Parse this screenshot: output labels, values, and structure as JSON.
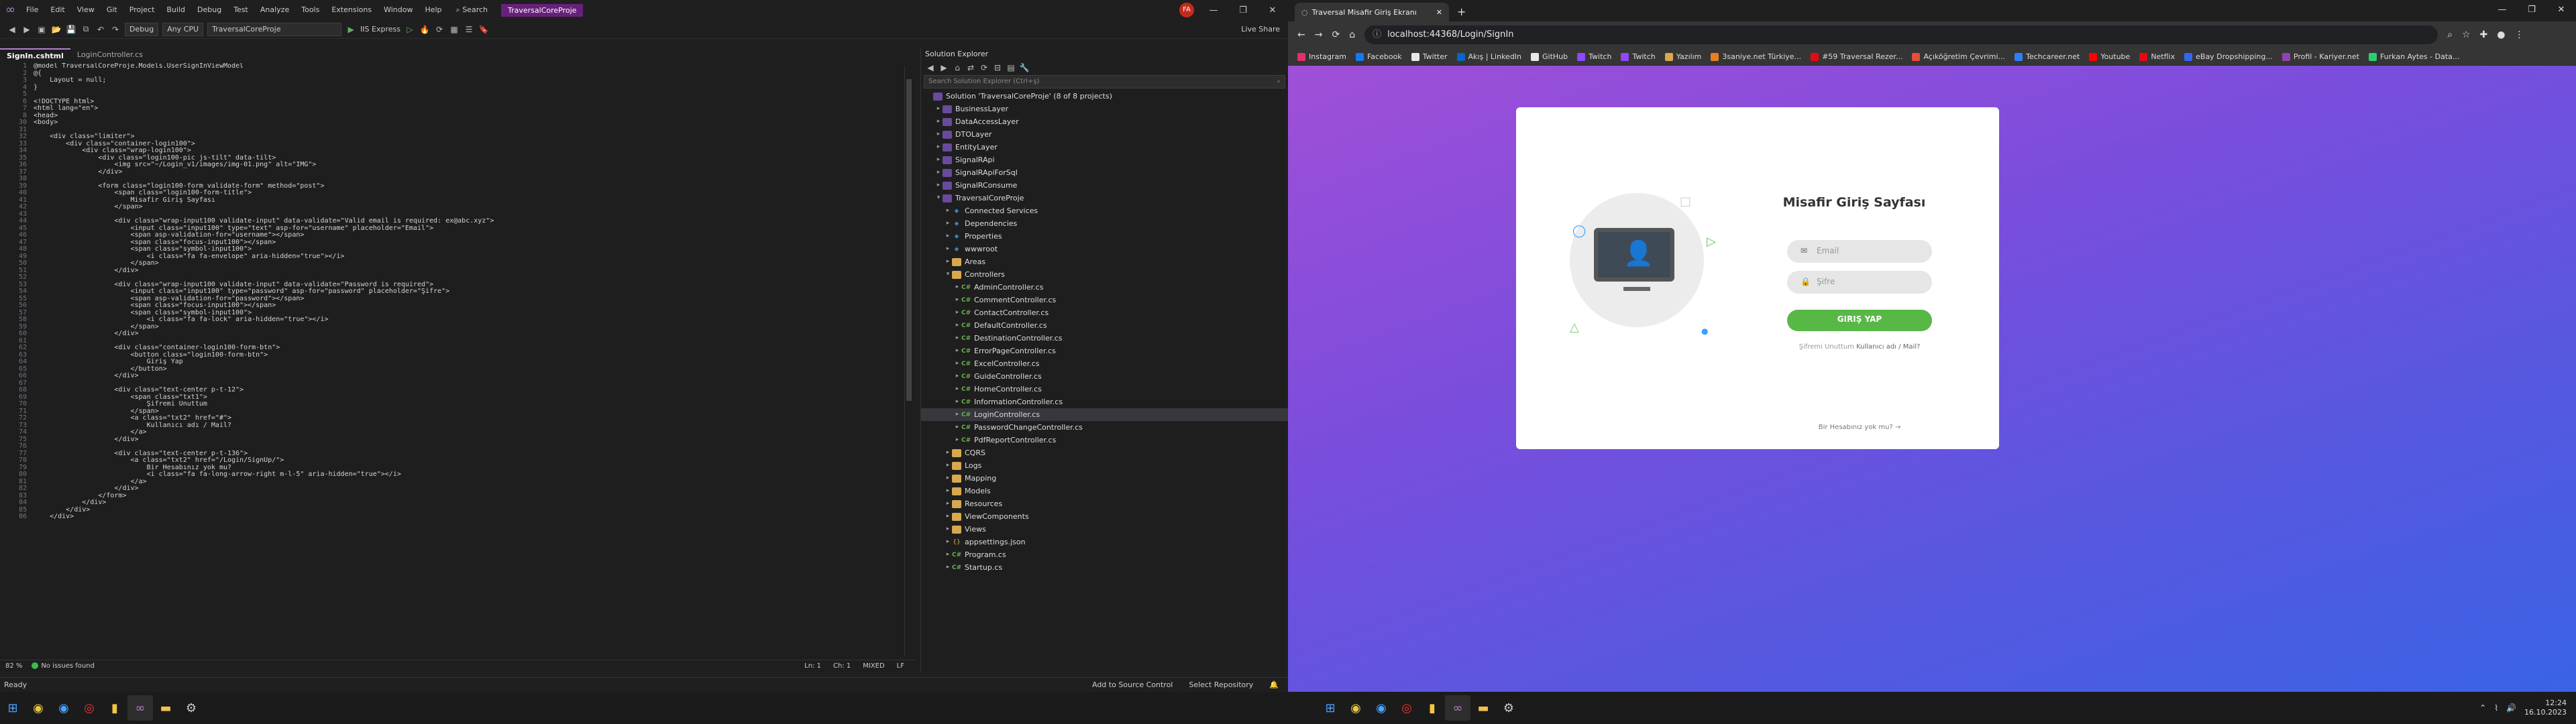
{
  "vs": {
    "menu": [
      "File",
      "Edit",
      "View",
      "Git",
      "Project",
      "Build",
      "Debug",
      "Test",
      "Analyze",
      "Tools",
      "Extensions",
      "Window",
      "Help"
    ],
    "search_label": "Search",
    "solution_name": "TraversalCoreProje",
    "avatar_initials": "FA",
    "live_share": "Live Share",
    "toolbar": {
      "config": "Debug",
      "platform": "Any CPU",
      "startup_project": "TraversalCoreProje",
      "run_target": "IIS Express"
    },
    "tabs": [
      "SignIn.cshtml",
      "LoginController.cs"
    ],
    "breadcrumb": "",
    "code": [
      {
        "n": "1",
        "t": "@model TraversalCoreProje.Models.UserSignInViewModel"
      },
      {
        "n": "2",
        "t": "@{"
      },
      {
        "n": "3",
        "t": "    Layout = null;"
      },
      {
        "n": "4",
        "t": "}"
      },
      {
        "n": "5",
        "t": ""
      },
      {
        "n": "6",
        "t": "<!DOCTYPE html>"
      },
      {
        "n": "7",
        "t": "<html lang=\"en\">"
      },
      {
        "n": "8",
        "t": "<head>"
      },
      {
        "n": "30",
        "t": "<body>"
      },
      {
        "n": "31",
        "t": ""
      },
      {
        "n": "32",
        "t": "    <div class=\"limiter\">"
      },
      {
        "n": "33",
        "t": "        <div class=\"container-login100\">"
      },
      {
        "n": "34",
        "t": "            <div class=\"wrap-login100\">"
      },
      {
        "n": "35",
        "t": "                <div class=\"login100-pic js-tilt\" data-tilt>"
      },
      {
        "n": "36",
        "t": "                    <img src=\"~/Login_v1/images/img-01.png\" alt=\"IMG\">"
      },
      {
        "n": "37",
        "t": "                </div>"
      },
      {
        "n": "38",
        "t": ""
      },
      {
        "n": "39",
        "t": "                <form class=\"login100-form validate-form\" method=\"post\">"
      },
      {
        "n": "40",
        "t": "                    <span class=\"login100-form-title\">"
      },
      {
        "n": "41",
        "t": "                        Misafir Giriş Sayfası"
      },
      {
        "n": "42",
        "t": "                    </span>"
      },
      {
        "n": "43",
        "t": ""
      },
      {
        "n": "44",
        "t": "                    <div class=\"wrap-input100 validate-input\" data-validate=\"Valid email is required: ex@abc.xyz\">"
      },
      {
        "n": "45",
        "t": "                        <input class=\"input100\" type=\"text\" asp-for=\"username\" placeholder=\"Email\">"
      },
      {
        "n": "46",
        "t": "                        <span asp-validation-for=\"username\"></span>"
      },
      {
        "n": "47",
        "t": "                        <span class=\"focus-input100\"></span>"
      },
      {
        "n": "48",
        "t": "                        <span class=\"symbol-input100\">"
      },
      {
        "n": "49",
        "t": "                            <i class=\"fa fa-envelope\" aria-hidden=\"true\"></i>"
      },
      {
        "n": "50",
        "t": "                        </span>"
      },
      {
        "n": "51",
        "t": "                    </div>"
      },
      {
        "n": "52",
        "t": ""
      },
      {
        "n": "53",
        "t": "                    <div class=\"wrap-input100 validate-input\" data-validate=\"Password is required\">"
      },
      {
        "n": "54",
        "t": "                        <input class=\"input100\" type=\"password\" asp-for=\"password\" placeholder=\"Şifre\">"
      },
      {
        "n": "55",
        "t": "                        <span asp-validation-for=\"password\"></span>"
      },
      {
        "n": "56",
        "t": "                        <span class=\"focus-input100\"></span>"
      },
      {
        "n": "57",
        "t": "                        <span class=\"symbol-input100\">"
      },
      {
        "n": "58",
        "t": "                            <i class=\"fa fa-lock\" aria-hidden=\"true\"></i>"
      },
      {
        "n": "59",
        "t": "                        </span>"
      },
      {
        "n": "60",
        "t": "                    </div>"
      },
      {
        "n": "61",
        "t": ""
      },
      {
        "n": "62",
        "t": "                    <div class=\"container-login100-form-btn\">"
      },
      {
        "n": "63",
        "t": "                        <button class=\"login100-form-btn\">"
      },
      {
        "n": "64",
        "t": "                            Giriş Yap"
      },
      {
        "n": "65",
        "t": "                        </button>"
      },
      {
        "n": "66",
        "t": "                    </div>"
      },
      {
        "n": "67",
        "t": ""
      },
      {
        "n": "68",
        "t": "                    <div class=\"text-center p-t-12\">"
      },
      {
        "n": "69",
        "t": "                        <span class=\"txt1\">"
      },
      {
        "n": "70",
        "t": "                            Şifremi Unuttum"
      },
      {
        "n": "71",
        "t": "                        </span>"
      },
      {
        "n": "72",
        "t": "                        <a class=\"txt2\" href=\"#\">"
      },
      {
        "n": "73",
        "t": "                            Kullanıcı adı / Mail?"
      },
      {
        "n": "74",
        "t": "                        </a>"
      },
      {
        "n": "75",
        "t": "                    </div>"
      },
      {
        "n": "76",
        "t": ""
      },
      {
        "n": "77",
        "t": "                    <div class=\"text-center p-t-136\">"
      },
      {
        "n": "78",
        "t": "                        <a class=\"txt2\" href=\"/Login/SignUp/\">"
      },
      {
        "n": "79",
        "t": "                            Bir Hesabınız yok mu?"
      },
      {
        "n": "80",
        "t": "                            <i class=\"fa fa-long-arrow-right m-l-5\" aria-hidden=\"true\"></i>"
      },
      {
        "n": "81",
        "t": "                        </a>"
      },
      {
        "n": "82",
        "t": "                    </div>"
      },
      {
        "n": "83",
        "t": "                </form>"
      },
      {
        "n": "84",
        "t": "            </div>"
      },
      {
        "n": "85",
        "t": "        </div>"
      },
      {
        "n": "86",
        "t": "    </div>"
      }
    ],
    "editor_status": {
      "zoom": "82 %",
      "issues": "No issues found",
      "ln": "Ln: 1",
      "ch": "Ch: 1",
      "mode": "MIXED",
      "eol": "LF"
    },
    "solution_explorer": {
      "title": "Solution Explorer",
      "search_placeholder": "Search Solution Explorer (Ctrl+ş)",
      "items": [
        {
          "label": "Solution 'TraversalCoreProje' (8 of 8 projects)",
          "depth": 0,
          "icon": "sol",
          "arrow": ""
        },
        {
          "label": "BusinessLayer",
          "depth": 1,
          "icon": "proj",
          "arrow": "▸"
        },
        {
          "label": "DataAccessLayer",
          "depth": 1,
          "icon": "proj",
          "arrow": "▸"
        },
        {
          "label": "DTOLayer",
          "depth": 1,
          "icon": "proj",
          "arrow": "▸"
        },
        {
          "label": "EntityLayer",
          "depth": 1,
          "icon": "proj",
          "arrow": "▸"
        },
        {
          "label": "SignalRApi",
          "depth": 1,
          "icon": "proj",
          "arrow": "▸"
        },
        {
          "label": "SignalRApiForSql",
          "depth": 1,
          "icon": "proj",
          "arrow": "▸"
        },
        {
          "label": "SignalRConsume",
          "depth": 1,
          "icon": "proj",
          "arrow": "▸"
        },
        {
          "label": "TraversalCoreProje",
          "depth": 1,
          "icon": "proj",
          "arrow": "▾"
        },
        {
          "label": "Connected Services",
          "depth": 2,
          "icon": "glb",
          "arrow": "▸"
        },
        {
          "label": "Dependencies",
          "depth": 2,
          "icon": "glb",
          "arrow": "▸"
        },
        {
          "label": "Properties",
          "depth": 2,
          "icon": "glb",
          "arrow": "▸"
        },
        {
          "label": "wwwroot",
          "depth": 2,
          "icon": "glb",
          "arrow": "▸"
        },
        {
          "label": "Areas",
          "depth": 2,
          "icon": "folder",
          "arrow": "▸"
        },
        {
          "label": "Controllers",
          "depth": 2,
          "icon": "folder",
          "arrow": "▾"
        },
        {
          "label": "AdminController.cs",
          "depth": 3,
          "icon": "cs",
          "arrow": "▸"
        },
        {
          "label": "CommentController.cs",
          "depth": 3,
          "icon": "cs",
          "arrow": "▸"
        },
        {
          "label": "ContactController.cs",
          "depth": 3,
          "icon": "cs",
          "arrow": "▸"
        },
        {
          "label": "DefaultController.cs",
          "depth": 3,
          "icon": "cs",
          "arrow": "▸"
        },
        {
          "label": "DestinationController.cs",
          "depth": 3,
          "icon": "cs",
          "arrow": "▸"
        },
        {
          "label": "ErrorPageController.cs",
          "depth": 3,
          "icon": "cs",
          "arrow": "▸"
        },
        {
          "label": "ExcelController.cs",
          "depth": 3,
          "icon": "cs",
          "arrow": "▸"
        },
        {
          "label": "GuideController.cs",
          "depth": 3,
          "icon": "cs",
          "arrow": "▸"
        },
        {
          "label": "HomeController.cs",
          "depth": 3,
          "icon": "cs",
          "arrow": "▸"
        },
        {
          "label": "InformationController.cs",
          "depth": 3,
          "icon": "cs",
          "arrow": "▸"
        },
        {
          "label": "LoginController.cs",
          "depth": 3,
          "icon": "cs",
          "arrow": "▸",
          "selected": true
        },
        {
          "label": "PasswordChangeController.cs",
          "depth": 3,
          "icon": "cs",
          "arrow": "▸"
        },
        {
          "label": "PdfReportController.cs",
          "depth": 3,
          "icon": "cs",
          "arrow": "▸"
        },
        {
          "label": "CQRS",
          "depth": 2,
          "icon": "folder",
          "arrow": "▸"
        },
        {
          "label": "Logs",
          "depth": 2,
          "icon": "folder",
          "arrow": "▸"
        },
        {
          "label": "Mapping",
          "depth": 2,
          "icon": "folder",
          "arrow": "▸"
        },
        {
          "label": "Models",
          "depth": 2,
          "icon": "folder",
          "arrow": "▸"
        },
        {
          "label": "Resources",
          "depth": 2,
          "icon": "folder",
          "arrow": "▸"
        },
        {
          "label": "ViewComponents",
          "depth": 2,
          "icon": "folder",
          "arrow": "▸"
        },
        {
          "label": "Views",
          "depth": 2,
          "icon": "folder",
          "arrow": "▸"
        },
        {
          "label": "appsettings.json",
          "depth": 2,
          "icon": "json",
          "arrow": "▸"
        },
        {
          "label": "Program.cs",
          "depth": 2,
          "icon": "cs",
          "arrow": "▸"
        },
        {
          "label": "Startup.cs",
          "depth": 2,
          "icon": "cs",
          "arrow": "▸"
        }
      ]
    },
    "status": {
      "ready": "Ready",
      "source_control": "Add to Source Control",
      "repository": "Select Repository"
    }
  },
  "taskbar": {
    "time": "12:24",
    "date": "16.10.2023"
  },
  "chrome": {
    "tab_title": "Traversal Misafir Giriş Ekranı",
    "url": "localhost:44368/Login/SignIn",
    "bookmarks": [
      "Instagram",
      "Facebook",
      "Twitter",
      "Akış | LinkedIn",
      "GitHub",
      "Twitch",
      "Twitch",
      "Yazılım",
      "3saniye.net Türkiye...",
      "#59 Traversal Rezer...",
      "Açıköğretim Çevrimi...",
      "Techcareer.net",
      "Youtube",
      "Netflix",
      "eBay Dropshipping...",
      "Profil - Kariyer.net",
      "Furkan Aytes - Data..."
    ],
    "bookmark_colors": [
      "#e1306c",
      "#1877f2",
      "#e8e8e8",
      "#0a66c2",
      "#e8e8e8",
      "#9146ff",
      "#9146ff",
      "#d8a84f",
      "#e67e22",
      "#e50914",
      "#e74c3c",
      "#2d7ff9",
      "#ff0000",
      "#e50914",
      "#3665f3",
      "#8e44ad",
      "#2ecc71"
    ]
  },
  "login": {
    "title": "Misafir Giriş Sayfası",
    "email_placeholder": "Email",
    "password_placeholder": "Şifre",
    "button": "GIRIŞ YAP",
    "forgot_text": "Şifremi Unuttum",
    "forgot_link": "Kullanıcı adı / Mail?",
    "signup_text": "Bir Hesabınız yok mu? →"
  }
}
